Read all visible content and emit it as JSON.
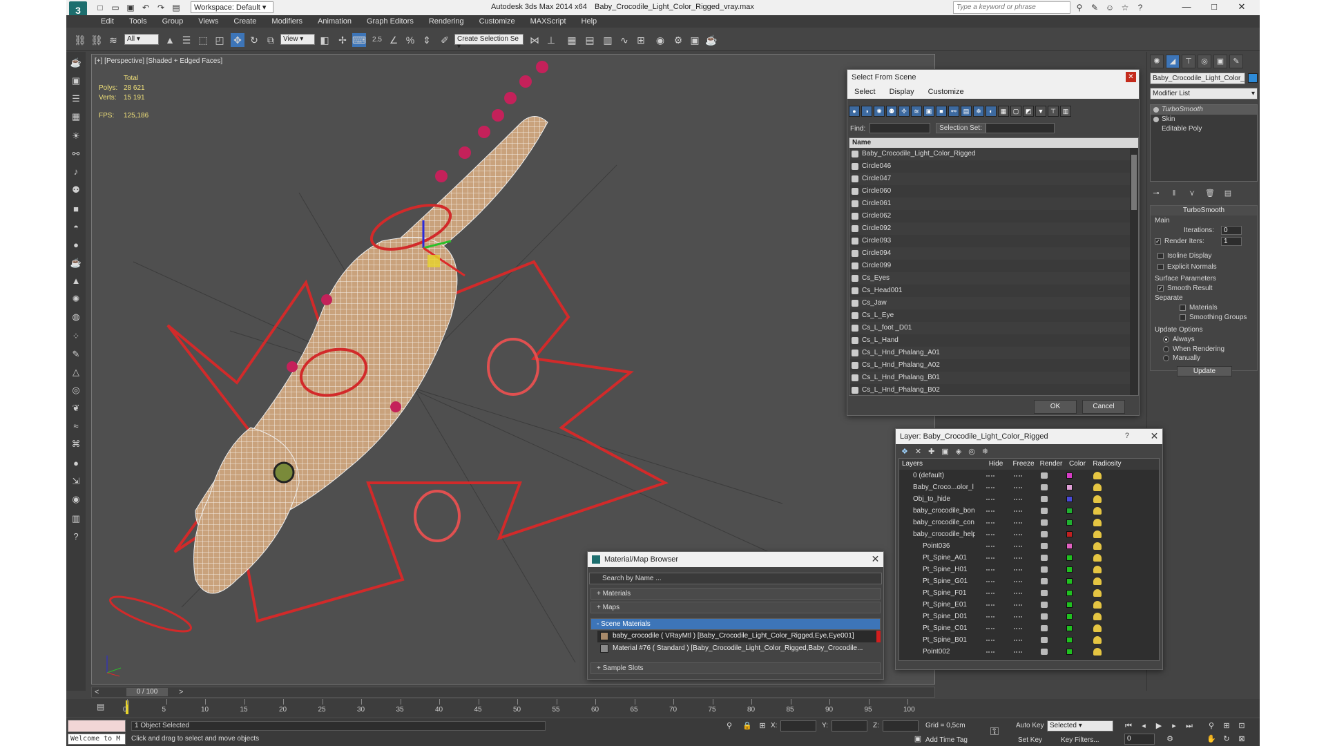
{
  "app": {
    "title": "Autodesk 3ds Max  2014 x64",
    "file": "Baby_Crocodile_Light_Color_Rigged_vray.max",
    "workspace": "Workspace: Default",
    "search_placeholder": "Type a keyword or phrase"
  },
  "menu": [
    "Edit",
    "Tools",
    "Group",
    "Views",
    "Create",
    "Modifiers",
    "Animation",
    "Graph Editors",
    "Rendering",
    "Customize",
    "MAXScript",
    "Help"
  ],
  "toolbar": {
    "filter": "All",
    "ref_coord": "View",
    "selection_set": "Create Selection Se",
    "snap_label": "2.5",
    "percent_label": "%"
  },
  "viewport": {
    "label": "[+] [Perspective] [Shaded + Edged Faces]",
    "stats_total": "Total",
    "polys_label": "Polys:",
    "polys": "28 621",
    "verts_label": "Verts:",
    "verts": "15 191",
    "fps_label": "FPS:",
    "fps": "125,186"
  },
  "command_panel": {
    "object_name": "Baby_Crocodile_Light_Color_",
    "object_color": "#2e8bd8",
    "modifier_list": "Modifier List",
    "stack": [
      "TurboSmooth",
      "Skin",
      "Editable Poly"
    ],
    "rollout_title": "TurboSmooth",
    "main_label": "Main",
    "iterations_label": "Iterations:",
    "iterations": "0",
    "render_iters_label": "Render Iters:",
    "render_iters": "1",
    "isoline": "Isoline Display",
    "explicit_normals": "Explicit Normals",
    "surface_params": "Surface Parameters",
    "smooth_result": "Smooth Result",
    "separate": "Separate",
    "materials": "Materials",
    "smoothing_groups": "Smoothing Groups",
    "update_options": "Update Options",
    "always": "Always",
    "when_rendering": "When Rendering",
    "manually": "Manually",
    "update": "Update"
  },
  "select_from_scene": {
    "title": "Select From Scene",
    "menu": [
      "Select",
      "Display",
      "Customize"
    ],
    "find_label": "Find:",
    "selection_set_label": "Selection Set:",
    "column": "Name",
    "rows": [
      "Baby_Crocodile_Light_Color_Rigged",
      "Circle046",
      "Circle047",
      "Circle060",
      "Circle061",
      "Circle062",
      "Circle092",
      "Circle093",
      "Circle094",
      "Circle099",
      "Cs_Eyes",
      "Cs_Head001",
      "Cs_Jaw",
      "Cs_L_Eye",
      "Cs_L_foot _D01",
      "Cs_L_Hand",
      "Cs_L_Hnd_Phalang_A01",
      "Cs_L_Hnd_Phalang_A02",
      "Cs_L_Hnd_Phalang_B01",
      "Cs_L_Hnd_Phalang_B02"
    ],
    "ok": "OK",
    "cancel": "Cancel"
  },
  "layer_dialog": {
    "title": "Layer: Baby_Crocodile_Light_Color_Rigged",
    "help": "?",
    "columns": [
      "Layers",
      "Hide",
      "Freeze",
      "Render",
      "Color",
      "Radiosity"
    ],
    "rows": [
      {
        "name": "0 (default)",
        "color": "#d63cc6",
        "indent": 0
      },
      {
        "name": "Baby_Croco...olor_l",
        "color": "#e0a0d8",
        "indent": 0
      },
      {
        "name": "Obj_to_hide",
        "color": "#4a4ad8",
        "indent": 0
      },
      {
        "name": "baby_crocodile_bon",
        "color": "#20b030",
        "indent": 0
      },
      {
        "name": "baby_crocodile_con",
        "color": "#20b030",
        "indent": 0
      },
      {
        "name": "baby_crocodile_help",
        "color": "#c02020",
        "indent": 0
      },
      {
        "name": "Point036",
        "color": "#e060c0",
        "indent": 1
      },
      {
        "name": "Pt_Spine_A01",
        "color": "#20c020",
        "indent": 1
      },
      {
        "name": "Pt_Spine_H01",
        "color": "#20c020",
        "indent": 1
      },
      {
        "name": "Pt_Spine_G01",
        "color": "#20c020",
        "indent": 1
      },
      {
        "name": "Pt_Spine_F01",
        "color": "#20c020",
        "indent": 1
      },
      {
        "name": "Pt_Spine_E01",
        "color": "#20c020",
        "indent": 1
      },
      {
        "name": "Pt_Spine_D01",
        "color": "#20c020",
        "indent": 1
      },
      {
        "name": "Pt_Spine_C01",
        "color": "#20c020",
        "indent": 1
      },
      {
        "name": "Pt_Spine_B01",
        "color": "#20c020",
        "indent": 1
      },
      {
        "name": "Point002",
        "color": "#20c020",
        "indent": 1
      }
    ]
  },
  "material_browser": {
    "title": "Material/Map Browser",
    "search": "Search by Name ...",
    "materials": "+ Materials",
    "maps": "+ Maps",
    "scene_materials": "- Scene Materials",
    "items": [
      "baby_crocodile ( VRayMtl ) [Baby_Crocodile_Light_Color_Rigged,Eye,Eye001]",
      "Material #76 ( Standard ) [Baby_Crocodile_Light_Color_Rigged,Baby_Crocodile..."
    ],
    "sample_slots": "+ Sample Slots"
  },
  "timeline": {
    "frame": "0 / 100",
    "ticks": [
      "0",
      "5",
      "10",
      "15",
      "20",
      "25",
      "30",
      "35",
      "40",
      "45",
      "50",
      "55",
      "60",
      "65",
      "70",
      "75",
      "80",
      "85",
      "90",
      "95",
      "100"
    ]
  },
  "status": {
    "maxscript": "Welcome to M",
    "selected": "1 Object Selected",
    "prompt": "Click and drag to select and move objects",
    "x_label": "X:",
    "y_label": "Y:",
    "z_label": "Z:",
    "grid": "Grid = 0,5cm",
    "add_time_tag": "Add Time Tag",
    "auto_key": "Auto Key",
    "set_key": "Set Key",
    "selected_mode": "Selected",
    "key_filters": "Key Filters...",
    "frame_value": "0"
  }
}
